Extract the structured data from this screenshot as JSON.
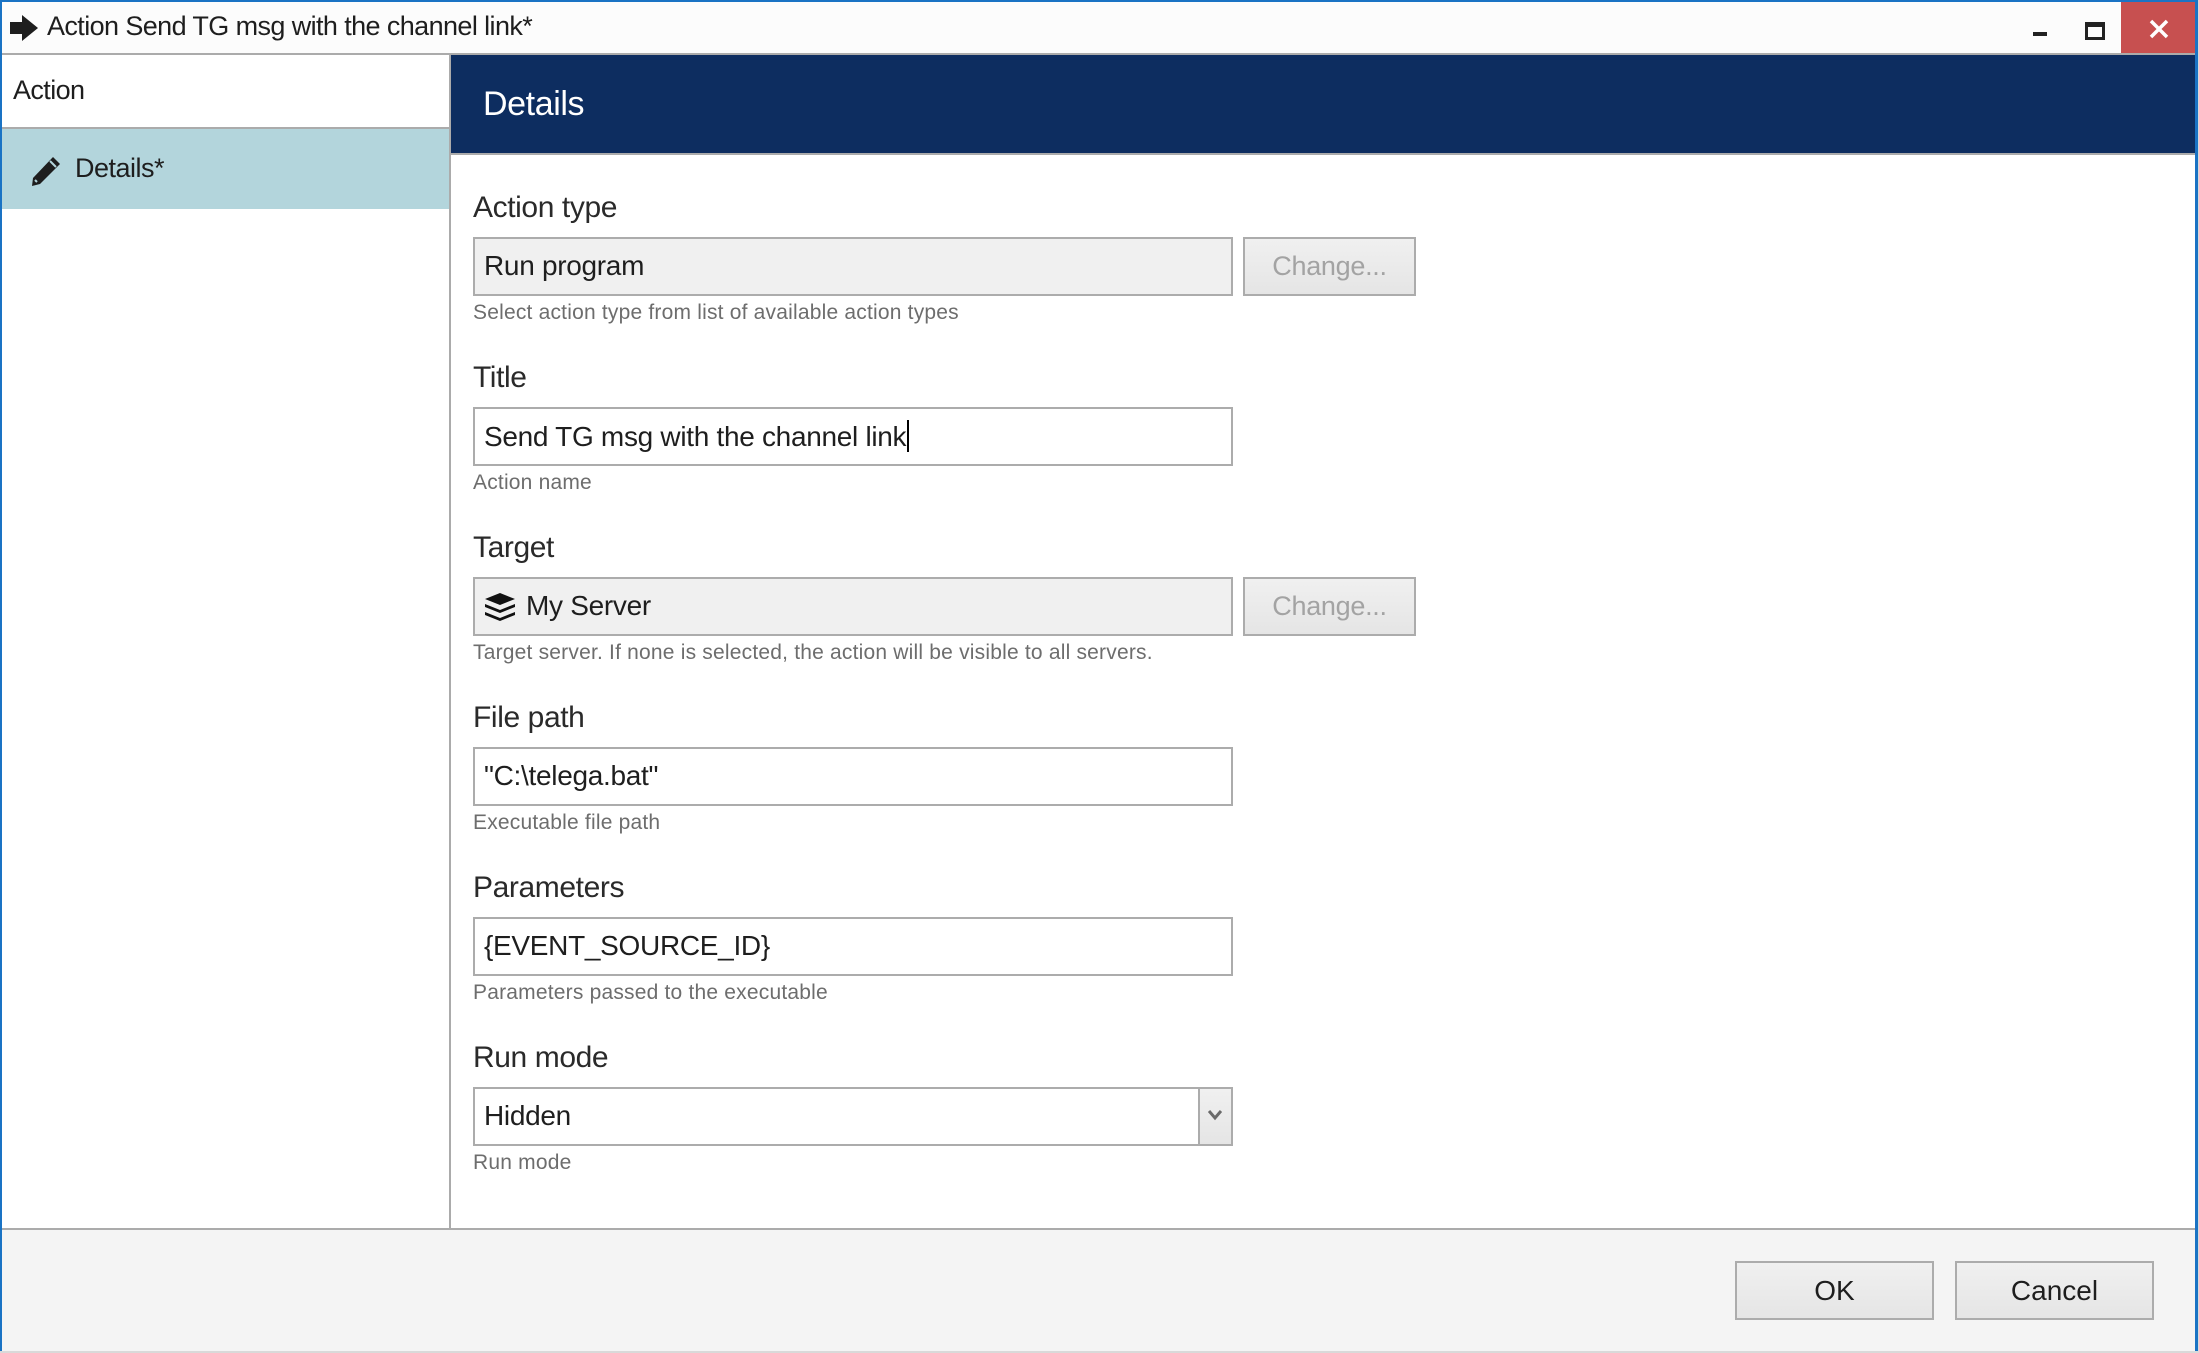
{
  "window": {
    "title": "Action Send TG msg with the channel link*",
    "title_icon": "arrow-right-icon",
    "controls": {
      "minimize": "minimize-icon",
      "maximize": "maximize-icon",
      "close": "close-icon"
    },
    "accent_color": "#1a73c4",
    "close_hover_color": "#c75050"
  },
  "sidebar": {
    "header": "Action",
    "items": [
      {
        "label": "Details*",
        "icon": "pencil-icon",
        "selected": true
      }
    ],
    "selected_color": "#b3d5dc"
  },
  "panel": {
    "title": "Details",
    "header_color": "#0d2d60"
  },
  "form": {
    "action_type": {
      "label": "Action type",
      "value": "Run program",
      "helper": "Select action type from list of available action types",
      "button": "Change...",
      "readonly": true
    },
    "title": {
      "label": "Title",
      "value": "Send TG msg with the channel link",
      "helper": "Action name"
    },
    "target": {
      "label": "Target",
      "value": "My Server",
      "icon": "server-stack-icon",
      "helper": "Target server. If none is selected, the action will be visible to all servers.",
      "button": "Change...",
      "readonly": true
    },
    "file_path": {
      "label": "File path",
      "value": "\"C:\\telega.bat\"",
      "helper": "Executable file path"
    },
    "parameters": {
      "label": "Parameters",
      "value": "{EVENT_SOURCE_ID}",
      "helper": "Parameters passed to the executable"
    },
    "run_mode": {
      "label": "Run mode",
      "value": "Hidden",
      "helper": "Run mode"
    }
  },
  "footer": {
    "ok": "OK",
    "cancel": "Cancel"
  }
}
